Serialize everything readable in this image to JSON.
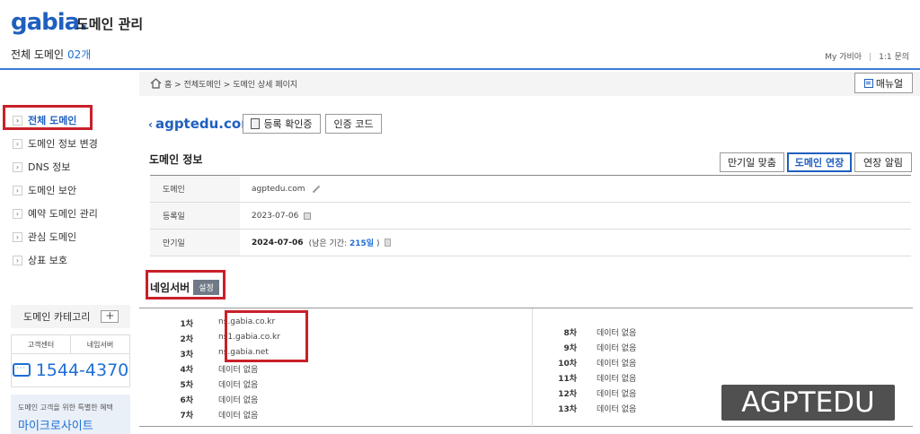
{
  "header": {
    "logo": "gabia.",
    "app_title": "도메인 관리",
    "all_domains_label": "전체 도메인",
    "domain_count": "02개",
    "links": [
      "My 가비아",
      "1:1 문의"
    ]
  },
  "breadcrumb": {
    "items": [
      "홈",
      "전체도메인",
      "도메인 상세 페이지"
    ],
    "text": "홈 > 전체도메인 > 도메인 상세 페이지",
    "manual_label": "매뉴얼"
  },
  "sidebar": {
    "items": [
      {
        "label": "전체 도메인",
        "active": true
      },
      {
        "label": "도메인 정보 변경"
      },
      {
        "label": "DNS 정보"
      },
      {
        "label": "도메인 보안"
      },
      {
        "label": "예약 도메인 관리"
      },
      {
        "label": "관심 도메인"
      },
      {
        "label": "상표 보호"
      }
    ],
    "category_label": "도메인 카테고리",
    "cs_tabs": [
      "고객센터",
      "네임서버"
    ],
    "phone": "1544-4370",
    "promo_line1": "도메인 고객을 위한 특별한 혜택",
    "promo_line2": "마이크로사이트"
  },
  "domain": {
    "name": "agptedu.com",
    "btn_reg_cert": "등록 확인증",
    "btn_auth_code": "인증 코드"
  },
  "domain_info": {
    "title": "도메인 정보",
    "actions": [
      "만기일 맞춤",
      "도메인 연장",
      "연장 알림"
    ],
    "rows": [
      {
        "label": "도메인",
        "value": "agptedu.com"
      },
      {
        "label": "등록일",
        "value": "2023-07-06"
      },
      {
        "label": "만기일",
        "value": "2024-07-06",
        "remaining_prefix": "(남은 기간:",
        "remaining_days": "215일",
        "remaining_suffix": ")"
      }
    ]
  },
  "nameservers": {
    "title": "네임서버",
    "set_label": "설정",
    "left": [
      {
        "order": "1차",
        "name": "ns.gabia.co.kr"
      },
      {
        "order": "2차",
        "name": "ns1.gabia.co.kr"
      },
      {
        "order": "3차",
        "name": "ns.gabia.net"
      },
      {
        "order": "4차",
        "name": "데이터 없음"
      },
      {
        "order": "5차",
        "name": "데이터 없음"
      },
      {
        "order": "6차",
        "name": "데이터 없음"
      },
      {
        "order": "7차",
        "name": "데이터 없음"
      }
    ],
    "right": [
      {
        "order": "8차",
        "name": "데이터 없음"
      },
      {
        "order": "9차",
        "name": "데이터 없음"
      },
      {
        "order": "10차",
        "name": "데이터 없음"
      },
      {
        "order": "11차",
        "name": "데이터 없음"
      },
      {
        "order": "12차",
        "name": "데이터 없음"
      },
      {
        "order": "13차",
        "name": "데이터 없음"
      }
    ]
  },
  "watermark": "AGPTEDU"
}
